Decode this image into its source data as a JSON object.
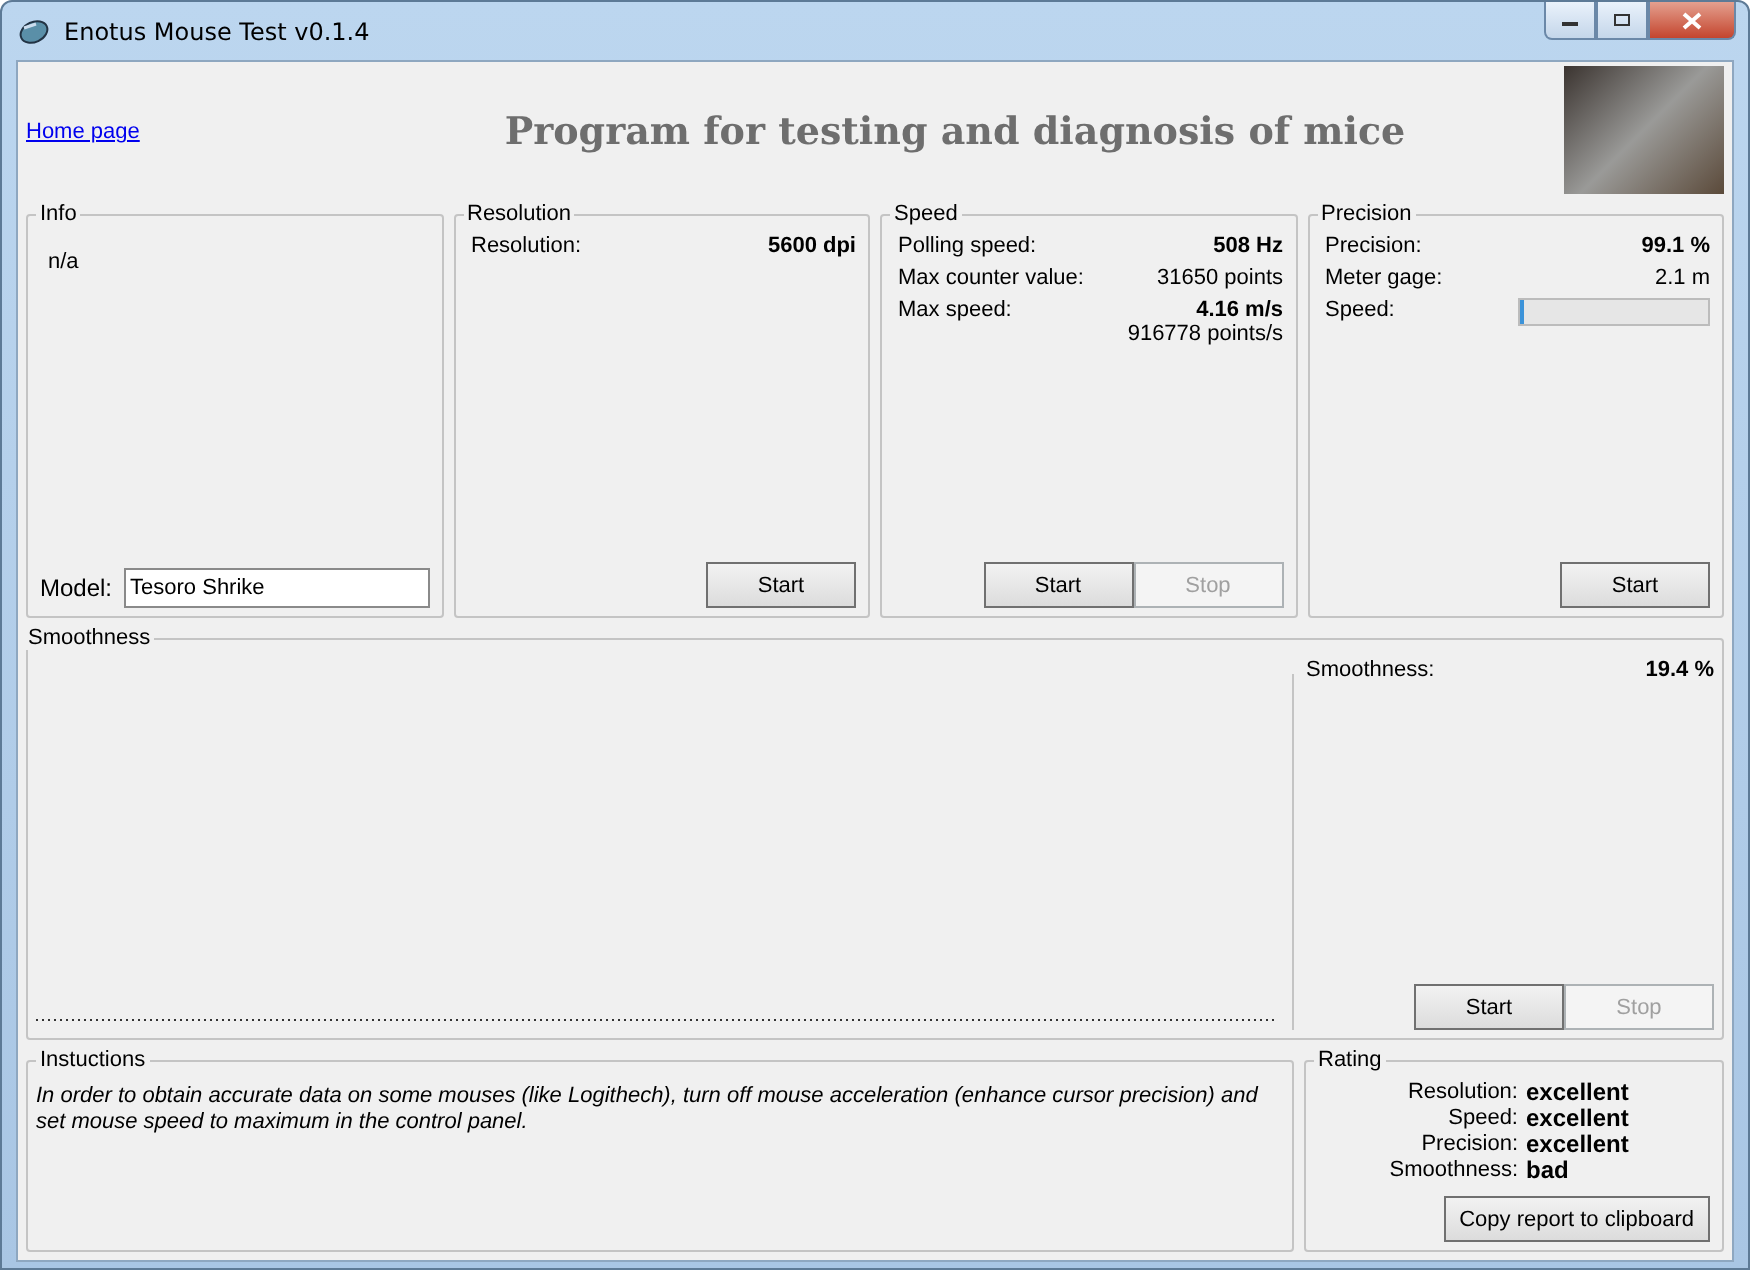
{
  "window": {
    "title": "Enotus Mouse Test v0.1.4"
  },
  "header": {
    "link": "Home page",
    "title": "Program for testing and diagnosis of mice"
  },
  "info": {
    "title": "Info",
    "text": "n/a",
    "model_label": "Model:",
    "model_value": "Tesoro Shrike"
  },
  "panels": [
    {
      "title": "Resolution",
      "rows": [
        {
          "kind": "value",
          "label": "Resolution:",
          "value": "5600 dpi",
          "bold": true
        }
      ],
      "buttons": [
        {
          "label": "Start",
          "disabled": false
        }
      ]
    },
    {
      "title": "Speed",
      "rows": [
        {
          "kind": "value",
          "label": "Polling speed:",
          "value": "508 Hz",
          "bold": true
        },
        {
          "kind": "value",
          "label": "Max counter value:",
          "value": "31650 points",
          "bold": false
        },
        {
          "kind": "value",
          "label": "Max  speed:",
          "value": "4.16 m/s",
          "bold": true,
          "sub": "916778 points/s"
        }
      ],
      "buttons": [
        {
          "label": "Start",
          "disabled": false
        },
        {
          "label": "Stop",
          "disabled": true
        }
      ]
    },
    {
      "title": "Precision",
      "rows": [
        {
          "kind": "value",
          "label": "Precision:",
          "value": "99.1 %",
          "bold": true
        },
        {
          "kind": "value",
          "label": "Meter gage:",
          "value": "2.1 m",
          "bold": false
        },
        {
          "kind": "meter",
          "label": "Speed:",
          "level": 0.01
        }
      ],
      "buttons": [
        {
          "label": "Start",
          "disabled": false
        }
      ]
    }
  ],
  "smoothness": {
    "title": "Smoothness",
    "rows": [
      {
        "kind": "value",
        "label": "Smoothness:",
        "value": "19.4 %",
        "bold": true
      }
    ],
    "buttons": [
      {
        "label": "Start",
        "disabled": false
      },
      {
        "label": "Stop",
        "disabled": true
      }
    ]
  },
  "instructions": {
    "title": "Instuctions",
    "text": "In order to obtain accurate data on some mouses (like Logithech), turn off mouse acceleration (enhance cursor precision) and set mouse speed to maximum in the control panel."
  },
  "rating": {
    "title": "Rating",
    "rows": [
      {
        "label": "Resolution:",
        "value": "excellent"
      },
      {
        "label": "Speed:",
        "value": "excellent"
      },
      {
        "label": "Precision:",
        "value": "excellent"
      },
      {
        "label": "Smoothness:",
        "value": "bad"
      }
    ],
    "button": "Copy report to clipboard"
  }
}
